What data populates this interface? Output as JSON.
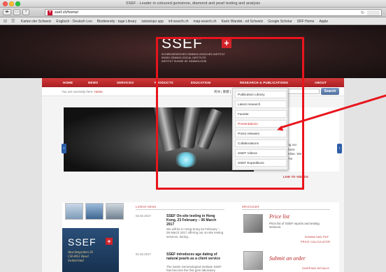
{
  "browser": {
    "window_title": "SSEF - Leader in coloured gemstone, diamond and pearl testing and analysis",
    "url": "ssef.ch/home/",
    "bookmarks": [
      "Karten der Schweiz",
      "Englisch - Deutsch Leo",
      "Biodiversity - tage Library",
      "swisstopo app",
      "inf-search.ch",
      "map-search.ch",
      "Karin Wandel...nd Schweiz",
      "Google Scholar",
      "SRF Home",
      "Apple"
    ]
  },
  "site": {
    "logo_text": "SSEF",
    "logo_sub": [
      "SCHWEIZERISCHES GEMMOLOGISCHES INSTITUT",
      "SWISS GEMMOLOGICAL INSTITUTE",
      "INSTITUT SUISSE DE GEMMOLOGIE"
    ],
    "nav": [
      "HOME",
      "NEWS",
      "SERVICES",
      "PRODUCTS",
      "EDUCATION",
      "RESEARCH & PUBLICATIONS",
      "ABOUT"
    ],
    "breadcrumb_prefix": "You are currently here: ",
    "breadcrumb_current": "Home",
    "languages": "简体 | 繁體 | ...",
    "search_button": "Search",
    "dropdown": [
      "Publication Library",
      "Latest research",
      "Facette",
      "Presentations",
      "Press releases",
      "Collaborations",
      "SSEF Videos",
      "SSEF Expeditions"
    ],
    "slide_text": [
      "...ulimating our",
      "...videos here",
      "...ur expertise. We",
      "...cover The"
    ],
    "live_link": "LIVE TO VIDEOS",
    "latest_news_heading": "LATEST NEWS",
    "spotlight_heading": "SPOTLIGHT",
    "news": [
      {
        "date": "02.02.2017",
        "title": "SSEF On-site testing in Hong Kong, 23 February – 06 March 2017",
        "body": "We will be in Hong Kong 23 February – 06 March 2017 offering our on-site testing services, during..."
      },
      {
        "date": "01.02.2017",
        "title": "SSEF introduces age dating of natural pearls as a client service",
        "body": "The Swiss Gemmological Institute SSEF has become the first gem laboratory"
      }
    ],
    "promo_lines": [
      "Anschengraben 26",
      "CH-4051 Basel",
      "Switzerland"
    ],
    "spotlight": {
      "price_title": "Price list",
      "price_body": "Price list of SSEF reports and testing services.",
      "price_link1": "DOWNLOAD PDF",
      "price_link2": "PRICE CALCULATOR",
      "order_title": "Submit an order",
      "order_link": "SHIPPING DETAILS"
    }
  },
  "colors": {
    "nav_red": "#c62f33",
    "annotation_red": "#e8141c",
    "search_blue": "#5b7bab"
  }
}
